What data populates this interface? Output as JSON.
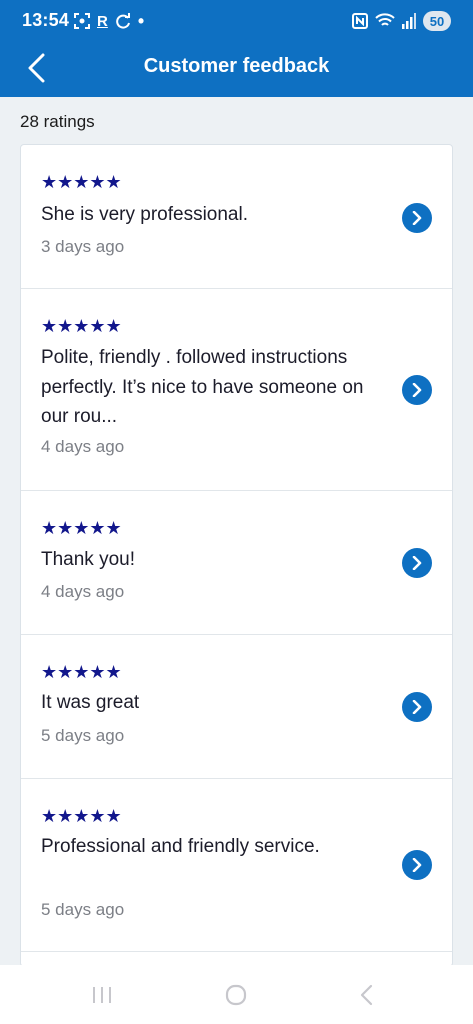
{
  "status_bar": {
    "time": "13:54",
    "battery": "50",
    "icons": [
      "screenshot-icon",
      "r-app-icon",
      "refresh-icon",
      "dot-icon",
      "nfc-icon",
      "wifi-icon",
      "signal-icon"
    ]
  },
  "header": {
    "title": "Customer feedback",
    "back_icon": "back-chevron-icon"
  },
  "summary": {
    "ratings_count": "28 ratings"
  },
  "feedback": [
    {
      "stars": "★★★★★",
      "rating": 5,
      "comment": "She is very professional.",
      "date": "3 days ago"
    },
    {
      "stars": "★★★★★",
      "rating": 5,
      "comment": "Polite, friendly . followed instructions perfectly. It’s nice to have someone on our rou...",
      "date": "4 days ago"
    },
    {
      "stars": "★★★★★",
      "rating": 5,
      "comment": "Thank you!",
      "date": "4 days ago"
    },
    {
      "stars": "★★★★★",
      "rating": 5,
      "comment": "It was great",
      "date": "5 days ago"
    },
    {
      "stars": "★★★★★",
      "rating": 5,
      "comment": "Professional and friendly service.",
      "date": "5 days ago"
    }
  ],
  "colors": {
    "primary": "#0e70c2",
    "star": "#12178c",
    "background": "#edf1f4"
  },
  "nav": {
    "buttons": [
      "recent-apps-icon",
      "home-icon",
      "back-nav-icon"
    ]
  }
}
